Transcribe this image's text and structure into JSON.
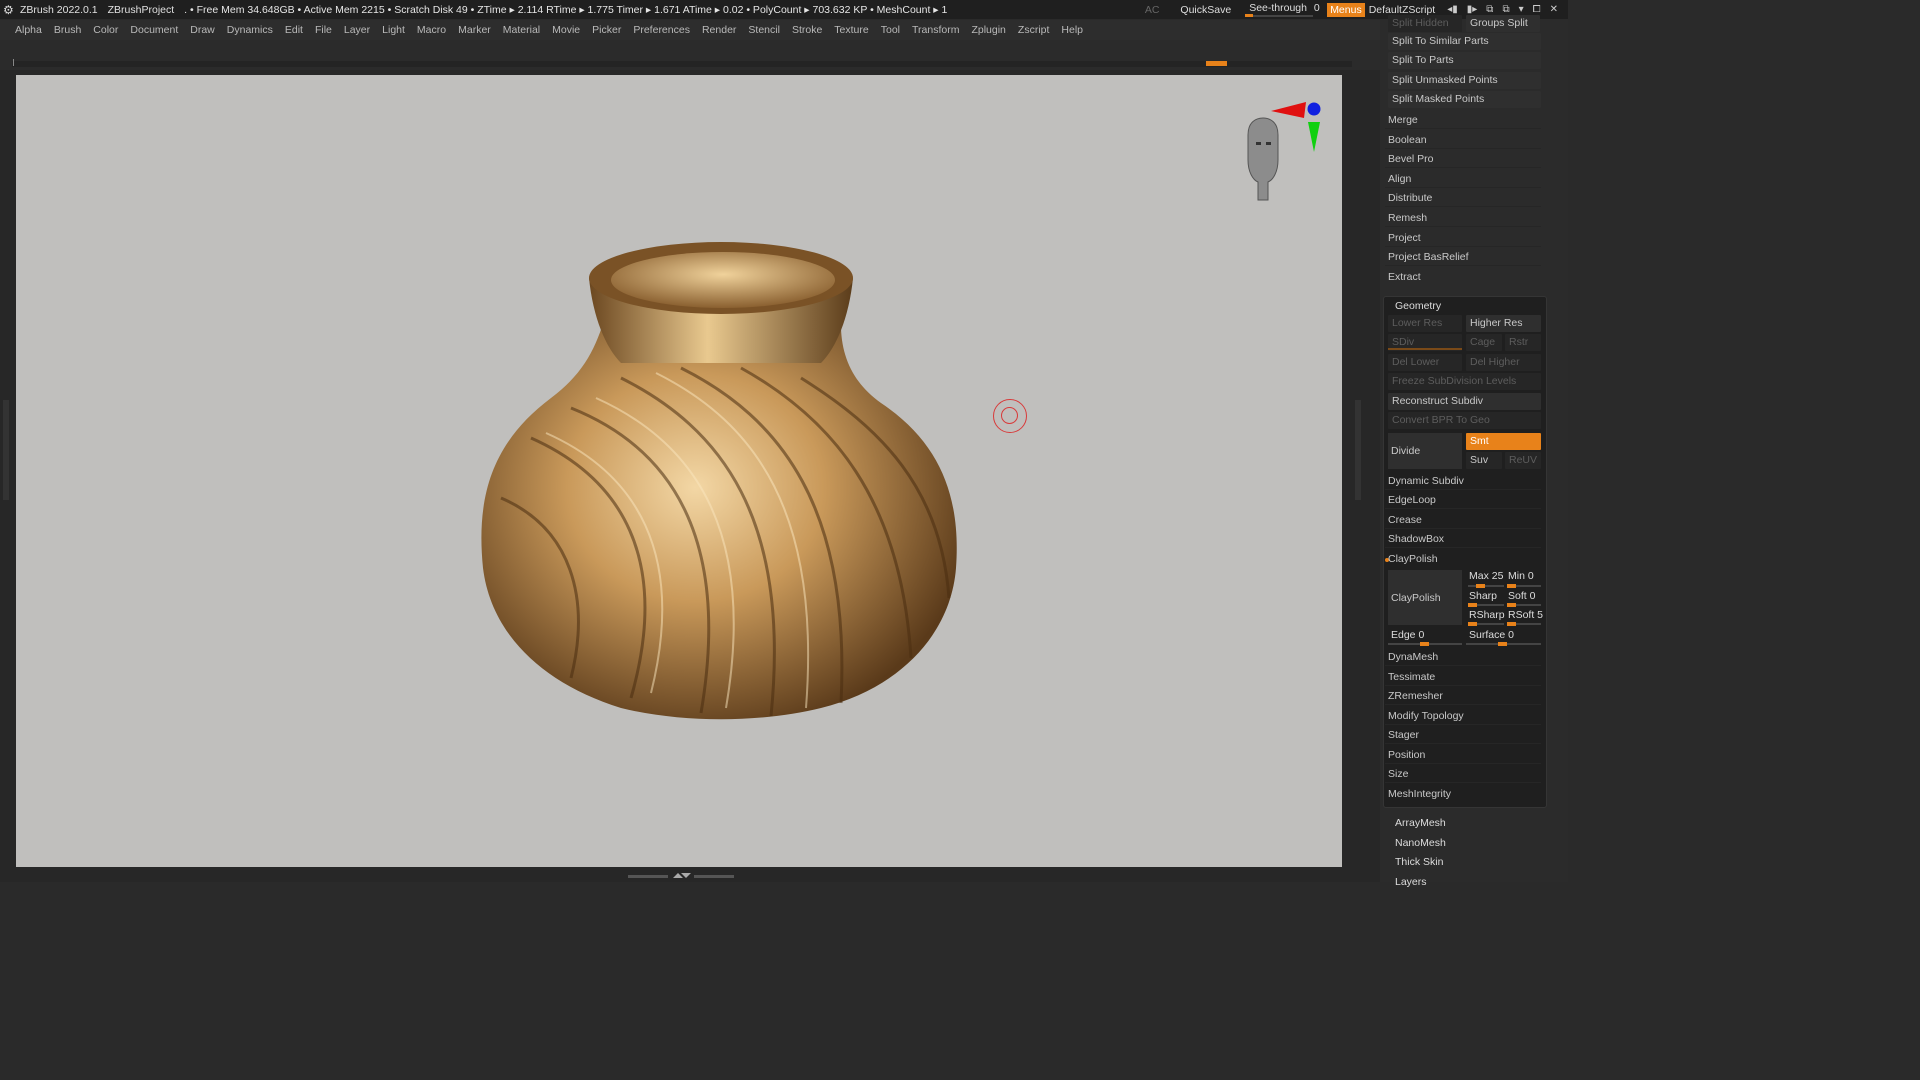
{
  "titlebar": {
    "app": "ZBrush 2022.0.1",
    "project": "ZBrushProject",
    "stats": ". • Free Mem 34.648GB • Active Mem 2215 • Scratch Disk 49 • ZTime ▸ 2.114 RTime ▸ 1.775 Timer ▸ 1.671 ATime ▸ 0.02 • PolyCount ▸ 703.632 KP • MeshCount ▸ 1",
    "ac": "AC",
    "quicksave": "QuickSave",
    "seethrough": "See-through",
    "seethrough_value": "0",
    "menus": "Menus",
    "script": "DefaultZScript"
  },
  "menubar": [
    "Alpha",
    "Brush",
    "Color",
    "Document",
    "Draw",
    "Dynamics",
    "Edit",
    "File",
    "Layer",
    "Light",
    "Macro",
    "Marker",
    "Material",
    "Movie",
    "Picker",
    "Preferences",
    "Render",
    "Stencil",
    "Stroke",
    "Texture",
    "Tool",
    "Transform",
    "Zplugin",
    "Zscript",
    "Help"
  ],
  "panel": {
    "top_cut_left": "Split Hidden",
    "top_cut_right": "Groups Split",
    "split_buttons": [
      "Split To Similar Parts",
      "Split To Parts",
      "Split Unmasked Points",
      "Split Masked Points"
    ],
    "subtool_rows": [
      "Merge",
      "Boolean",
      "Bevel Pro",
      "Align",
      "Distribute",
      "Remesh",
      "Project",
      "Project BasRelief",
      "Extract"
    ],
    "geometry": {
      "title": "Geometry",
      "lower_res": "Lower Res",
      "higher_res": "Higher Res",
      "sdiv": "SDiv",
      "cage": "Cage",
      "rstr": "Rstr",
      "del_lower": "Del Lower",
      "del_higher": "Del Higher",
      "freeze": "Freeze SubDivision Levels",
      "reconstruct": "Reconstruct Subdiv",
      "convert_bpr": "Convert BPR To Geo",
      "divide": "Divide",
      "smt": "Smt",
      "suv": "Suv",
      "reuv": "ReUV",
      "rows_a": [
        "Dynamic Subdiv",
        "EdgeLoop",
        "Crease",
        "ShadowBox"
      ],
      "claypolish": "ClayPolish",
      "claypolish_btn": "ClayPolish",
      "max": "Max 25",
      "min": "Min 0",
      "sharp": "Sharp",
      "soft": "Soft 0",
      "rsharp": "RSharp",
      "rsoft": "RSoft 5",
      "edge": "Edge 0",
      "surface": "Surface 0",
      "rows_b": [
        "DynaMesh",
        "Tessimate",
        "ZRemesher",
        "Modify Topology",
        "Stager",
        "Position",
        "Size",
        "MeshIntegrity"
      ]
    },
    "bottom_items": [
      "ArrayMesh",
      "NanoMesh",
      "Thick Skin",
      "Layers"
    ]
  },
  "colors": {
    "accent": "#e8821a",
    "viewport_bg": "#c0bfbd",
    "vase_gold": "#b8874a"
  },
  "icons": [
    "zbrush-logo-icon",
    "window-control-icons",
    "head-gizmo-icon",
    "axis-gizmo-icon",
    "cursor-ring-icon"
  ]
}
